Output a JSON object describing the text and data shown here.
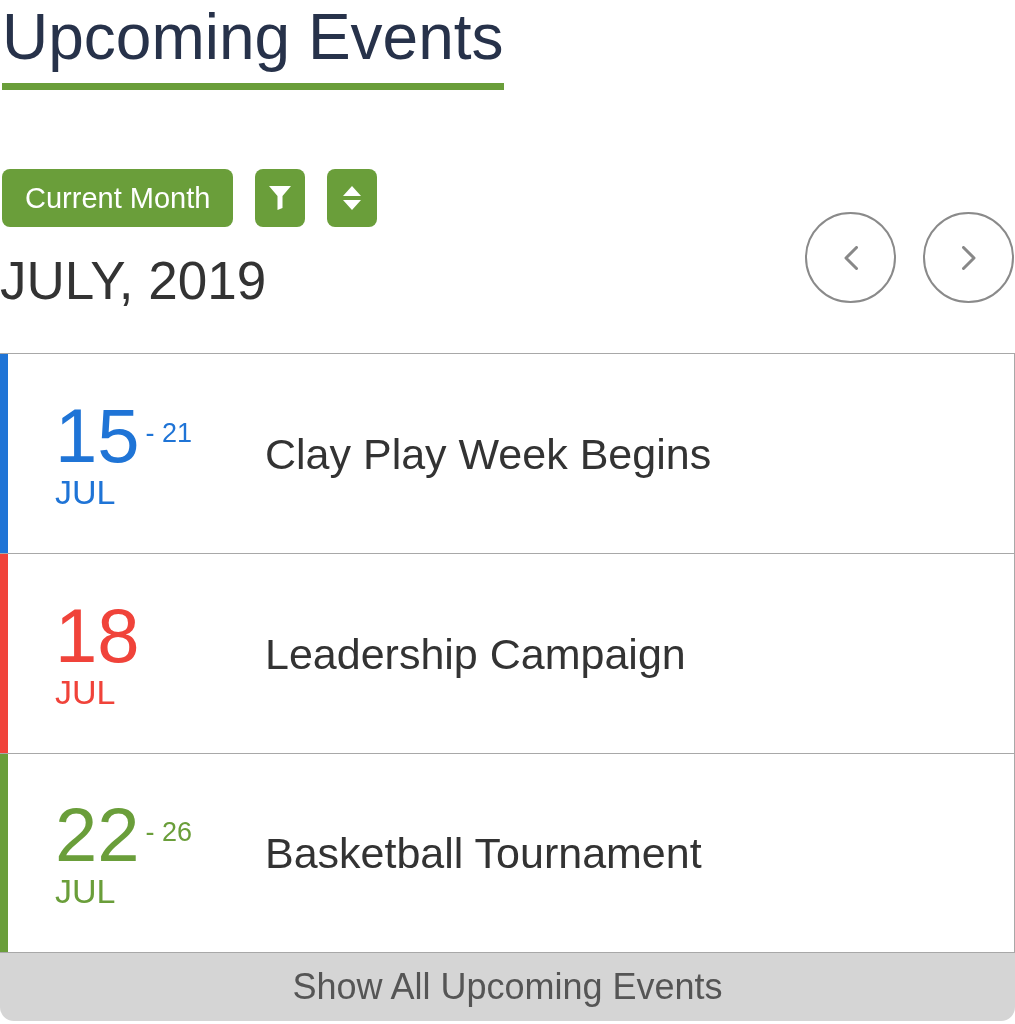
{
  "header": {
    "title": "Upcoming Events"
  },
  "toolbar": {
    "range_button": "Current Month"
  },
  "month": {
    "label": "JULY, 2019"
  },
  "events": [
    {
      "day": "15",
      "range_end": "- 21",
      "month": "JUL",
      "title": "Clay Play Week Begins",
      "color": "#1f74d6"
    },
    {
      "day": "18",
      "month": "JUL",
      "title": "Leadership Campaign",
      "color": "#f0433a"
    },
    {
      "day": "22",
      "range_end": "- 26",
      "month": "JUL",
      "title": "Basketball Tournament",
      "color": "#6a9e3a"
    }
  ],
  "footer": {
    "show_all": "Show All Upcoming Events"
  }
}
